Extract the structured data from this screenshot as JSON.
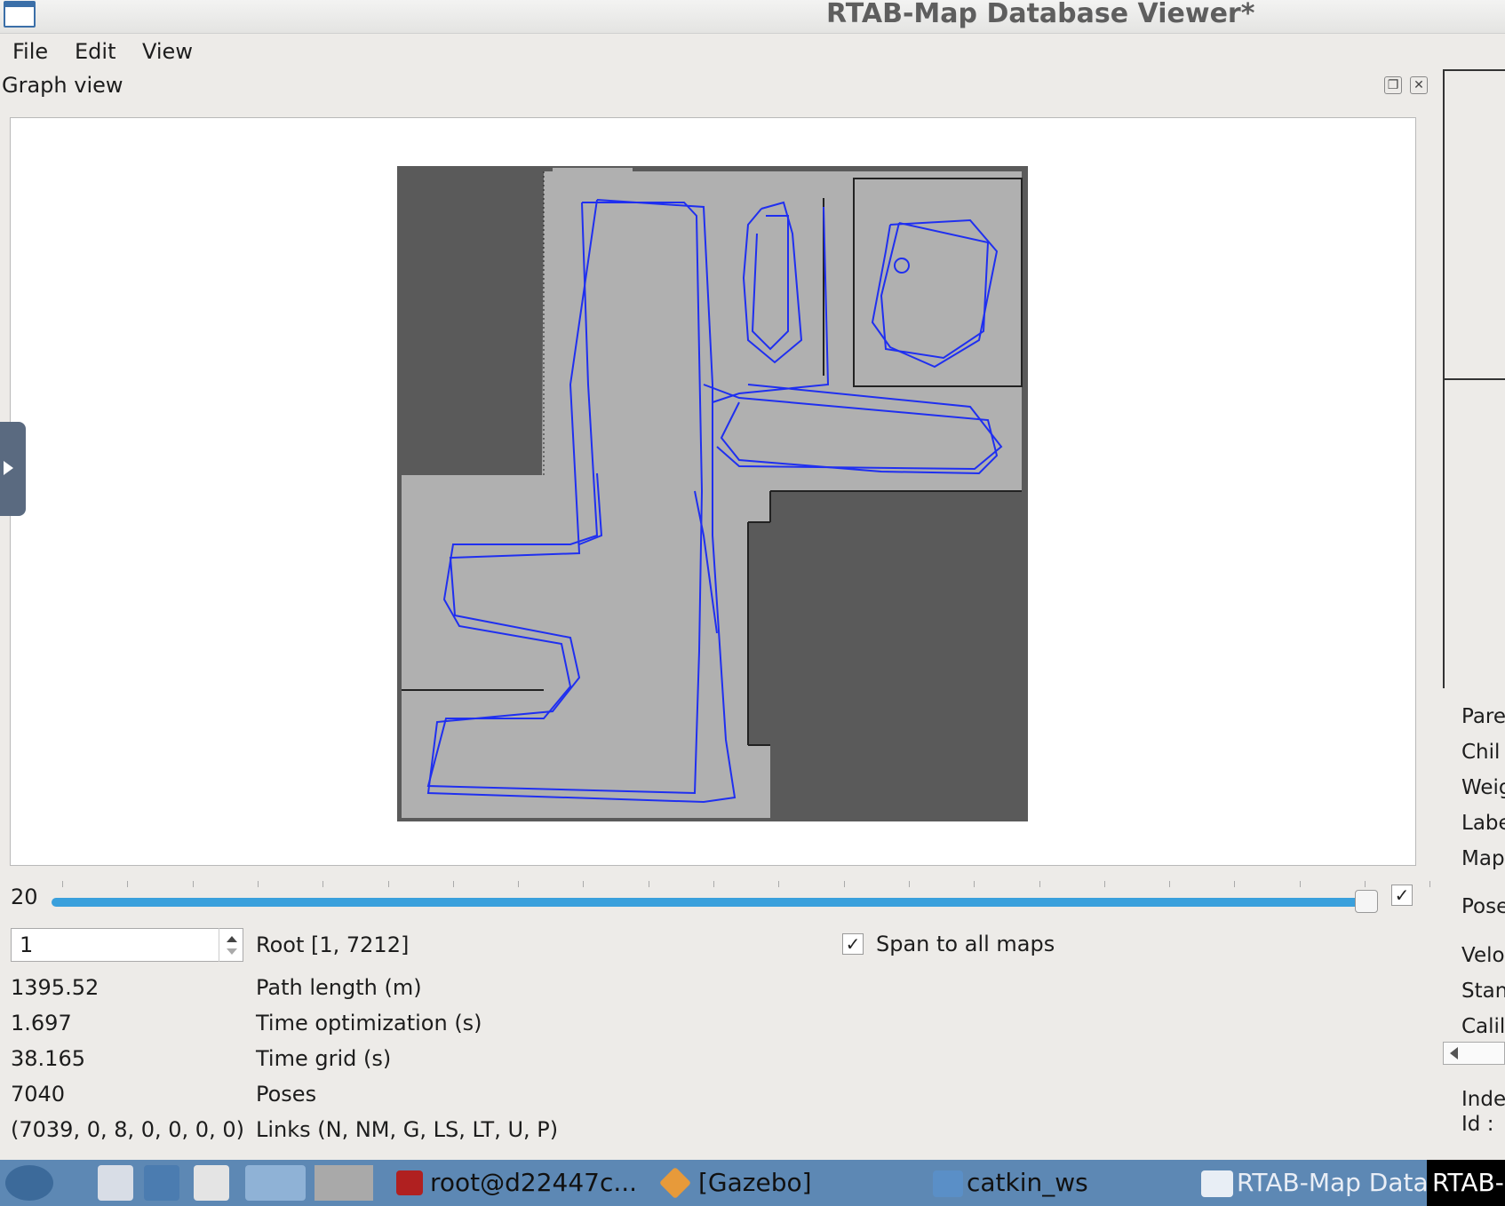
{
  "window": {
    "title": "RTAB-Map Database Viewer*"
  },
  "menu": [
    "File",
    "Edit",
    "View"
  ],
  "dock": {
    "title": "Graph view"
  },
  "slider": {
    "value_label": "20",
    "checked": true
  },
  "graph_controls": {
    "root_spin_value": "1",
    "root_label": "Root [1, 7212]",
    "span_checkbox_label": "Span to all maps"
  },
  "stats": [
    {
      "value": "1395.52",
      "label": "Path length (m)"
    },
    {
      "value": "1.697",
      "label": "Time optimization (s)"
    },
    {
      "value": "38.165",
      "label": "Time grid (s)"
    },
    {
      "value": "7040",
      "label": "Poses"
    },
    {
      "value": "(7039, 0, 8, 0, 0, 0, 0)",
      "label": "Links (N, NM, G, LS, LT, U, P)"
    }
  ],
  "right_panel": {
    "labels": [
      "Pare",
      "Chil",
      "Weig",
      "Labe",
      "Map",
      "Pose",
      "Velo",
      "Stan",
      "Calil"
    ],
    "footer": [
      "Inde",
      "Id :"
    ]
  },
  "taskbar": {
    "items": [
      "root@d22447c...",
      "[Gazebo]",
      "catkin_ws",
      "RTAB-Map Data",
      "RTAB-"
    ]
  },
  "icons": {
    "app": "window-icon",
    "float": "float-icon",
    "close": "close-icon",
    "expand": "play-arrow-icon"
  },
  "colors": {
    "trajectory": "#1f2ff0",
    "free_space": "#b0b0b0",
    "unknown": "#5a5a5a",
    "slider": "#3aa0dc",
    "taskbar": "#5d88b4"
  }
}
